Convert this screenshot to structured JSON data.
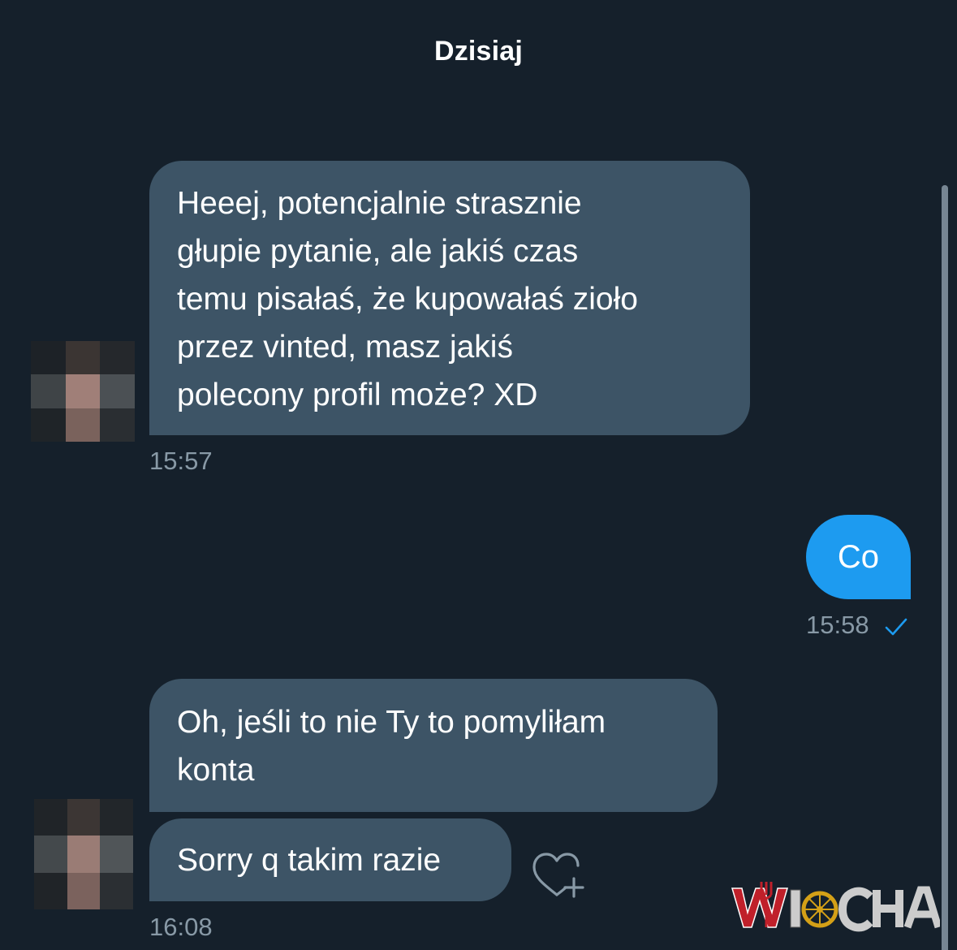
{
  "conversation": {
    "date_label": "Dzisiaj",
    "messages": [
      {
        "direction": "incoming",
        "text": "Heeej, potencjalnie strasznie\ngłupie pytanie, ale jakiś czas\ntemu pisałaś, że kupowałaś zioło\nprzez vinted, masz jakiś\npolecony profil może? XD",
        "time": "15:57"
      },
      {
        "direction": "outgoing",
        "text": "Co",
        "time": "15:58",
        "status_icon": "check-icon"
      },
      {
        "direction": "incoming",
        "text": "Oh, jeśli to nie Ty to pomyliłam\nkonta"
      },
      {
        "direction": "incoming",
        "text": "Sorry q takim razie",
        "time": "16:08",
        "reaction_icon": "heart-plus-icon"
      }
    ]
  },
  "colors": {
    "background": "#15202b",
    "incoming_bubble": "#3d5466",
    "outgoing_bubble": "#1d9bf0",
    "timestamp": "#8899a6",
    "check": "#1d9bf0"
  },
  "avatar": {
    "icon": "avatar-pixelated"
  },
  "watermark": {
    "text": "WIOCHA"
  }
}
